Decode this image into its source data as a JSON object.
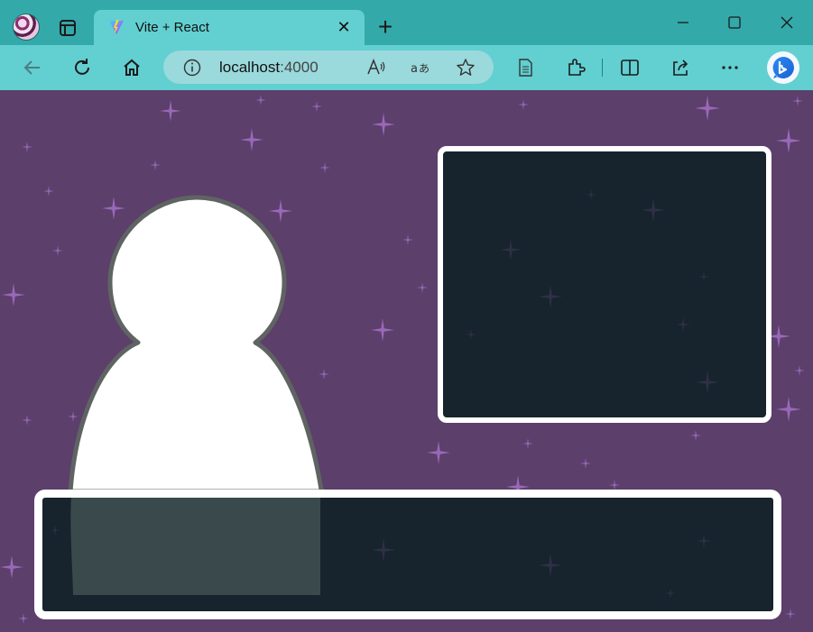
{
  "browser": {
    "tab": {
      "title": "Vite + React"
    },
    "address": {
      "host": "localhost",
      "port": ":4000"
    },
    "window_buttons": {
      "minimize": "—",
      "maximize": "☐",
      "close": "✕"
    }
  },
  "icons": [
    "workspaces-icon",
    "vite-favicon",
    "close-icon",
    "new-tab-icon",
    "back-icon",
    "refresh-icon",
    "home-icon",
    "info-icon",
    "read-aloud-icon",
    "translate-icon",
    "favorite-star-icon",
    "reading-view-icon",
    "extensions-icon",
    "split-screen-icon",
    "share-icon",
    "more-icon",
    "bing-icon"
  ],
  "colors": {
    "tab_strip": "#34a9a9",
    "toolbar": "#62cfd1",
    "background": "#5c3f6b",
    "panel": "#17232d",
    "panel_border": "#ffffff",
    "star": "#9a68b8",
    "figure": "#ffffff",
    "figure_outline": "#5f6462"
  }
}
